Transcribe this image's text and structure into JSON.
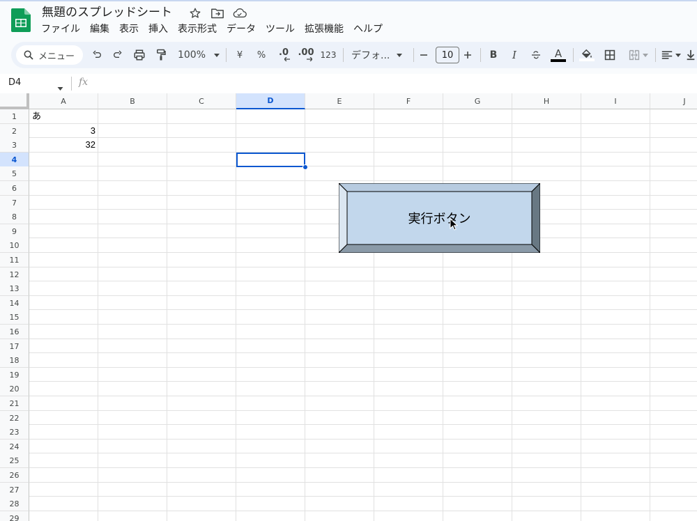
{
  "app": {
    "title": "無題のスプレッドシート"
  },
  "menu": [
    "ファイル",
    "編集",
    "表示",
    "挿入",
    "表示形式",
    "データ",
    "ツール",
    "拡張機能",
    "ヘルプ"
  ],
  "toolbar": {
    "search_label": "メニュー",
    "zoom": "100%",
    "currency": "¥",
    "percent": "%",
    "dec_decrease": ".0",
    "dec_increase": ".00",
    "number_format": "123",
    "font": "デフォ...",
    "font_size": "10",
    "bold": "B",
    "italic": "I",
    "text_color_label": "A",
    "text_color": "#000000"
  },
  "formula_bar": {
    "name_box": "D4",
    "fx": "fx",
    "value": ""
  },
  "grid": {
    "columns": [
      "A",
      "B",
      "C",
      "D",
      "E",
      "F",
      "G",
      "H",
      "I",
      "J"
    ],
    "rows": [
      "1",
      "2",
      "3",
      "4",
      "5",
      "6",
      "7",
      "8",
      "9",
      "10",
      "11",
      "12",
      "13",
      "14",
      "15",
      "16",
      "17",
      "18",
      "19",
      "20",
      "21",
      "22",
      "23",
      "24",
      "25",
      "26",
      "27",
      "28",
      "29"
    ],
    "selected_cell": "D4",
    "cells": {
      "A1": "あ",
      "A2": "3",
      "A3": "32"
    }
  },
  "drawing": {
    "label": "実行ボタン",
    "face_color": "#c2d7ec",
    "bevel_color": "#8a9aa8"
  }
}
